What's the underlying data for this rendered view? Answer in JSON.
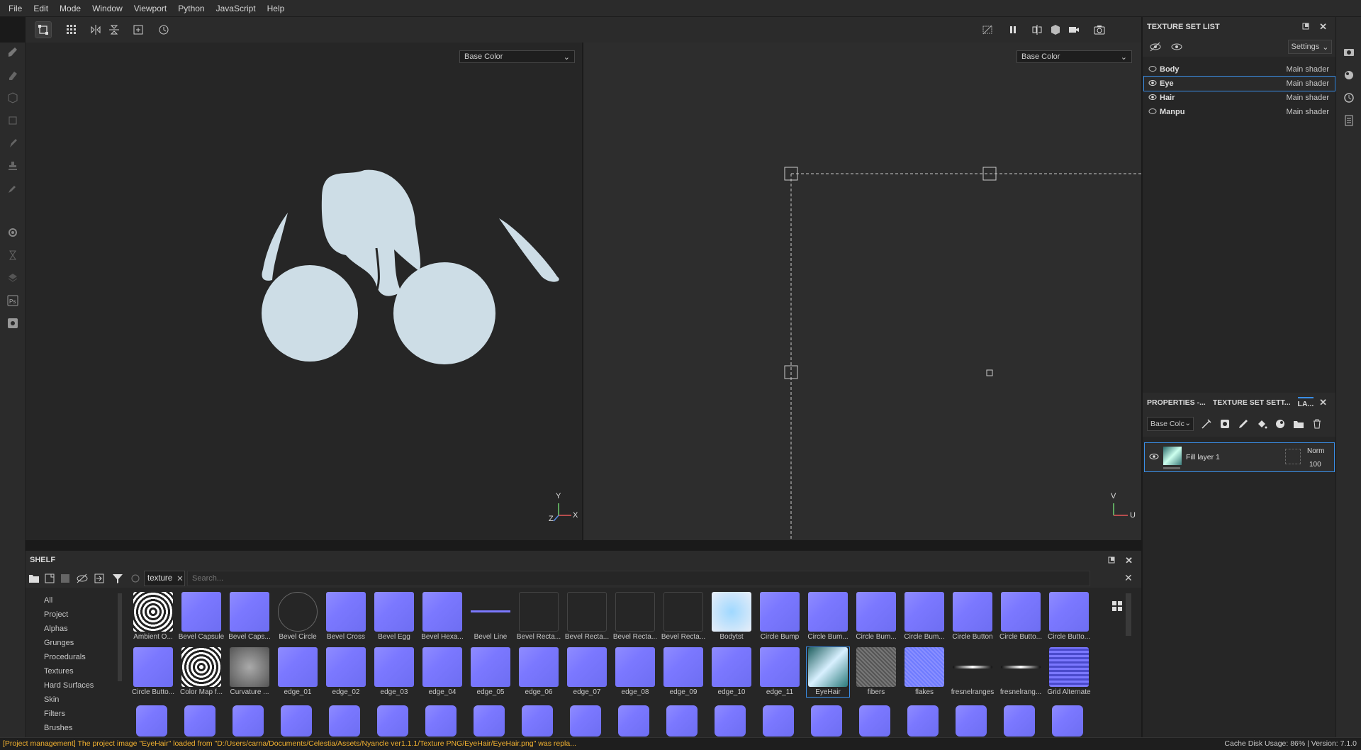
{
  "menu": [
    "File",
    "Edit",
    "Mode",
    "Window",
    "Viewport",
    "Python",
    "JavaScript",
    "Help"
  ],
  "viewport": {
    "left_channel": "Base Color",
    "right_channel": "Base Color",
    "axis_3d": {
      "y": "Y",
      "x": "X",
      "z": "Z"
    },
    "axis_uv": {
      "v": "V",
      "u": "U"
    }
  },
  "texture_set_list": {
    "title": "TEXTURE SET LIST",
    "settings_label": "Settings",
    "rows": [
      {
        "name": "Body",
        "shader": "Main shader",
        "selected": false,
        "visible": false
      },
      {
        "name": "Eye",
        "shader": "Main shader",
        "selected": true,
        "visible": true
      },
      {
        "name": "Hair",
        "shader": "Main shader",
        "selected": false,
        "visible": true
      },
      {
        "name": "Manpu",
        "shader": "Main shader",
        "selected": false,
        "visible": false
      }
    ]
  },
  "properties": {
    "tabs": [
      "PROPERTIES -...",
      "TEXTURE SET SETT...",
      "LA..."
    ],
    "channel_select": "Base Colc",
    "layer": {
      "name": "Fill layer 1",
      "blend": "Norm",
      "opacity": "100"
    }
  },
  "shelf": {
    "title": "SHELF",
    "filter_tag": "texture",
    "search_placeholder": "Search...",
    "categories": [
      "All",
      "Project",
      "Alphas",
      "Grunges",
      "Procedurals",
      "Textures",
      "Hard Surfaces",
      "Skin",
      "Filters",
      "Brushes"
    ],
    "row1": [
      "Ambient O...",
      "Bevel Capsule",
      "Bevel Caps...",
      "Bevel Circle",
      "Bevel Cross",
      "Bevel Egg",
      "Bevel Hexa...",
      "Bevel Line",
      "Bevel Recta...",
      "Bevel Recta...",
      "Bevel Recta...",
      "Bevel Recta...",
      "Bodytst",
      "Circle Bump",
      "Circle Bum...",
      "Circle Bum...",
      "Circle Bum...",
      "Circle Button",
      "Circle Butto...",
      "Circle Butto..."
    ],
    "row2": [
      "Circle Butto...",
      "Color Map f...",
      "Curvature ...",
      "edge_01",
      "edge_02",
      "edge_03",
      "edge_04",
      "edge_05",
      "edge_06",
      "edge_07",
      "edge_08",
      "edge_09",
      "edge_10",
      "edge_11",
      "EyeHair",
      "fibers",
      "flakes",
      "fresnelranges",
      "fresnelrang...",
      "Grid Alternate"
    ],
    "selected": "EyeHair"
  },
  "status": {
    "message": "[Project management] The project image \"EyeHair\" loaded from \"D:/Users/carna/Documents/Celestia/Assets/Nyancle ver1.1.1/Texture PNG/EyeHair/EyeHair.png\" was repla...",
    "cache": "Cache Disk Usage:   86% | Version: 7.1.0"
  },
  "colors": {
    "accent": "#3a8ee6",
    "status_warn": "#f0b030",
    "normal_map": "#7b78ff",
    "mask": "#cddde6"
  }
}
